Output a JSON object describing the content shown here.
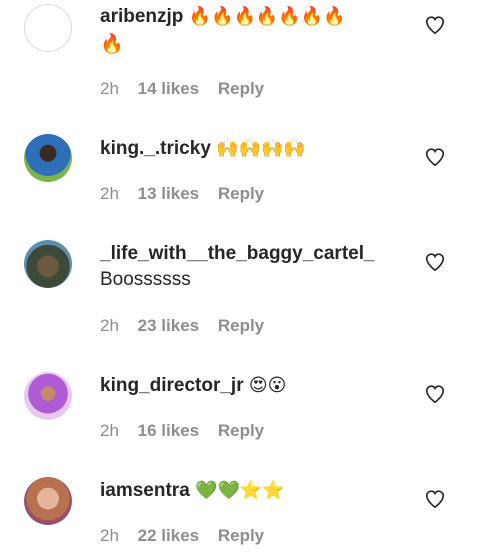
{
  "comments": [
    {
      "user": "aribenzjp",
      "emoji": "🔥🔥🔥🔥🔥🔥🔥",
      "emoji2": "🔥",
      "text": "",
      "time": "2h",
      "likes": "14 likes",
      "reply": "Reply"
    },
    {
      "user": "king._.tricky",
      "emoji": "🙌🙌🙌🙌",
      "emoji2": "",
      "text": "",
      "time": "2h",
      "likes": "13 likes",
      "reply": "Reply"
    },
    {
      "user": "_life_with__the_baggy_cartel_",
      "emoji": "",
      "emoji2": "",
      "text": "Boossssss",
      "time": "2h",
      "likes": "23 likes",
      "reply": "Reply"
    },
    {
      "user": "king_director_jr",
      "emoji": "😍😮",
      "emoji2": "",
      "text": "",
      "time": "2h",
      "likes": "16 likes",
      "reply": "Reply"
    },
    {
      "user": "iamsentra",
      "emoji": "💚💚⭐⭐",
      "emoji2": "",
      "text": "",
      "time": "2h",
      "likes": "22 likes",
      "reply": "Reply"
    }
  ],
  "colors": {
    "meta": "#8e8e8e",
    "text": "#262626"
  },
  "icons": {
    "like": "heart-outline-icon"
  }
}
